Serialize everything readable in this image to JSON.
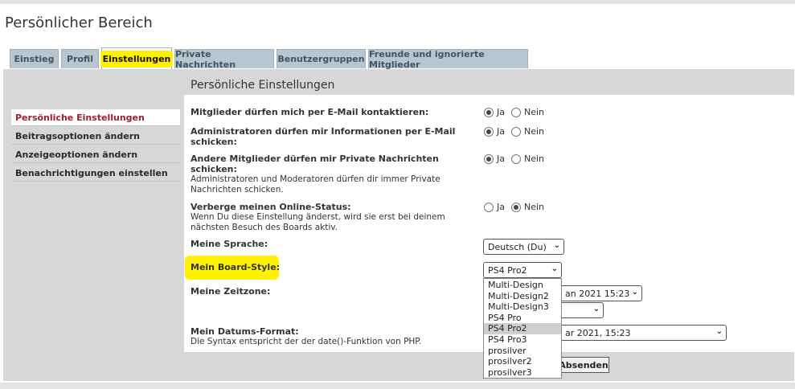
{
  "page": {
    "title": "Persönlicher Bereich"
  },
  "tabs": [
    {
      "label": "Einstieg"
    },
    {
      "label": "Profil"
    },
    {
      "label": "Einstellungen"
    },
    {
      "label": "Private Nachrichten"
    },
    {
      "label": "Benutzergruppen"
    },
    {
      "label": "Freunde und ignorierte Mitglieder"
    }
  ],
  "sidebar": {
    "items": [
      {
        "label": "Persönliche Einstellungen"
      },
      {
        "label": "Beitragsoptionen ändern"
      },
      {
        "label": "Anzeigeoptionen ändern"
      },
      {
        "label": "Benachrichtigungen einstellen"
      }
    ]
  },
  "main": {
    "section_title": "Persönliche Einstellungen",
    "yes": "Ja",
    "no": "Nein",
    "rows": [
      {
        "label": "Mitglieder dürfen mich per E-Mail kontaktieren:",
        "desc": "",
        "value": "Ja"
      },
      {
        "label": "Administratoren dürfen mir Informationen per E-Mail schicken:",
        "desc": "",
        "value": "Ja"
      },
      {
        "label": "Andere Mitglieder dürfen mir Private Nachrichten schicken:",
        "desc": "Administratoren und Moderatoren dürfen dir immer Private Nachrichten schicken.",
        "value": "Ja"
      },
      {
        "label": "Verberge meinen Online-Status:",
        "desc": "Wenn Du diese Einstellung änderst, wird sie erst bei deinem nächsten Besuch des Boards aktiv.",
        "value": "Nein"
      }
    ],
    "language": {
      "label": "Meine Sprache:",
      "value": "Deutsch (Du)"
    },
    "style": {
      "label": "Mein Board-Style:",
      "value": "PS4 Pro2",
      "options": [
        "Multi-Design",
        "Multi-Design2",
        "Multi-Design3",
        "PS4 Pro",
        "PS4 Pro2",
        "PS4 Pro3",
        "prosilver",
        "prosilver2",
        "prosilver3"
      ]
    },
    "timezone": {
      "label": "Meine Zeitzone:",
      "value_partial": "an 2021 15:23"
    },
    "dateformat": {
      "label": "Mein Datums-Format:",
      "desc": "Die Syntax entspricht der der date()-Funktion von PHP.",
      "value_partial": "ar 2021, 15:23"
    },
    "submit_label": "Absenden"
  }
}
